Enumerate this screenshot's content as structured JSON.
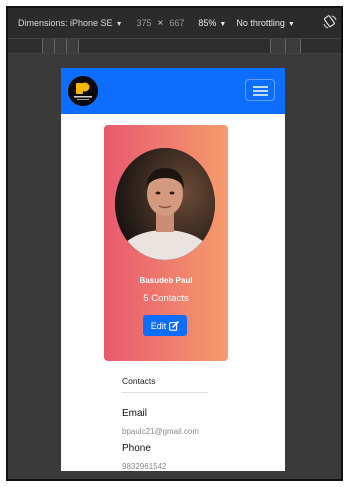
{
  "devtools": {
    "dimensions_label": "Dimensions: iPhone SE",
    "width": "375",
    "times": "×",
    "height": "667",
    "zoom": "85%",
    "throttling": "No throttling",
    "caret": "▼"
  },
  "navbar": {
    "brand_color": "#0d6efd"
  },
  "profile": {
    "name": "Basudeb Paul",
    "contacts_count": "5 Contacts",
    "edit_label": "Edit",
    "gradient_start": "#e8596e",
    "gradient_end": "#f59c6c"
  },
  "contacts": {
    "title": "Contacts",
    "email_label": "Email",
    "email_value": "bpaulc21@gmail.com",
    "phone_label": "Phone",
    "phone_value": "9832961542"
  },
  "icons": [
    "logo-icon",
    "menu-icon",
    "edit-icon",
    "rotate-icon"
  ]
}
